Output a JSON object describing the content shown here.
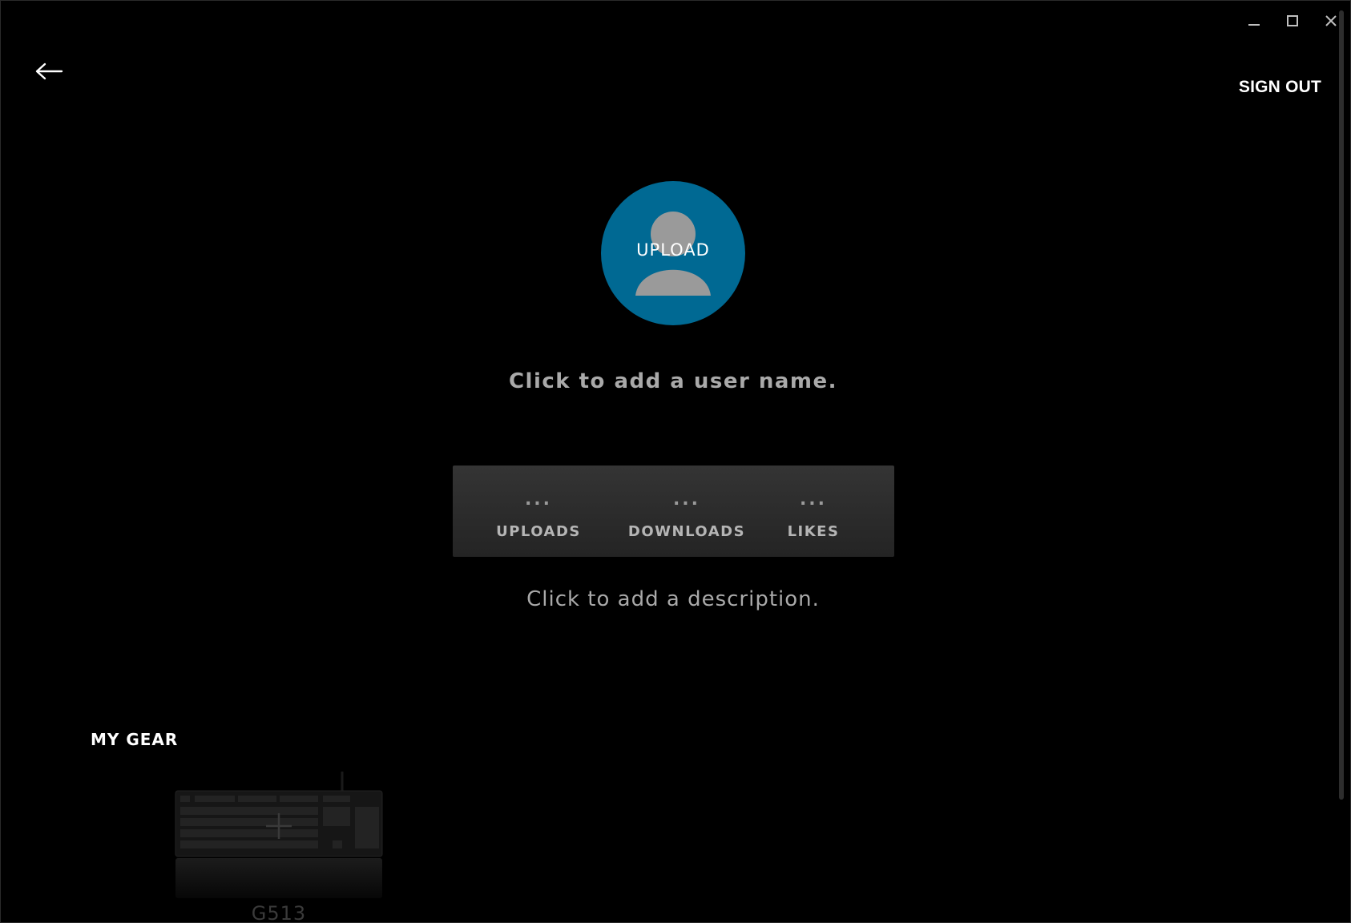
{
  "window": {
    "controls": {
      "minimize_icon": "minimize-icon",
      "maximize_icon": "maximize-icon",
      "close_icon": "close-icon"
    }
  },
  "header": {
    "back_icon": "back-arrow-icon",
    "sign_out_label": "SIGN OUT"
  },
  "profile": {
    "avatar_upload_label": "UPLOAD",
    "avatar_color": "#006993",
    "username_placeholder": "Click to add a user name.",
    "description_placeholder": "Click to add a description."
  },
  "stats": [
    {
      "value": "...",
      "label": "UPLOADS"
    },
    {
      "value": "...",
      "label": "DOWNLOADS"
    },
    {
      "value": "...",
      "label": "LIKES"
    }
  ],
  "gear": {
    "section_title": "MY GEAR",
    "items": [
      {
        "name": "G513",
        "icon": "keyboard-icon"
      }
    ]
  }
}
